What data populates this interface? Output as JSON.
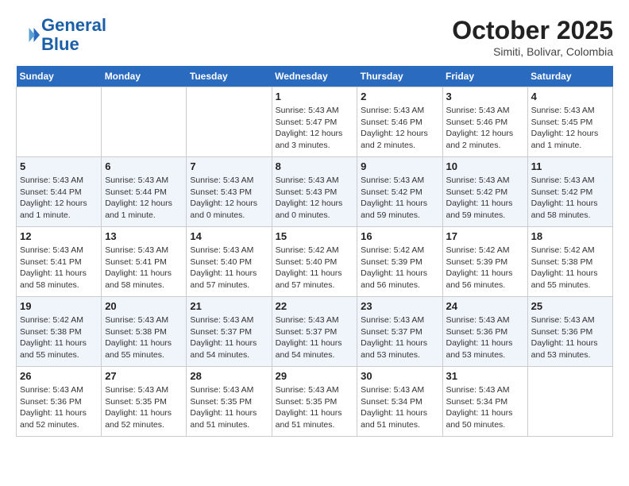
{
  "header": {
    "logo_line1": "General",
    "logo_line2": "Blue",
    "month": "October 2025",
    "location": "Simiti, Bolivar, Colombia"
  },
  "days_of_week": [
    "Sunday",
    "Monday",
    "Tuesday",
    "Wednesday",
    "Thursday",
    "Friday",
    "Saturday"
  ],
  "weeks": [
    [
      {
        "day": "",
        "info": ""
      },
      {
        "day": "",
        "info": ""
      },
      {
        "day": "",
        "info": ""
      },
      {
        "day": "1",
        "info": "Sunrise: 5:43 AM\nSunset: 5:47 PM\nDaylight: 12 hours and 3 minutes."
      },
      {
        "day": "2",
        "info": "Sunrise: 5:43 AM\nSunset: 5:46 PM\nDaylight: 12 hours and 2 minutes."
      },
      {
        "day": "3",
        "info": "Sunrise: 5:43 AM\nSunset: 5:46 PM\nDaylight: 12 hours and 2 minutes."
      },
      {
        "day": "4",
        "info": "Sunrise: 5:43 AM\nSunset: 5:45 PM\nDaylight: 12 hours and 1 minute."
      }
    ],
    [
      {
        "day": "5",
        "info": "Sunrise: 5:43 AM\nSunset: 5:44 PM\nDaylight: 12 hours and 1 minute."
      },
      {
        "day": "6",
        "info": "Sunrise: 5:43 AM\nSunset: 5:44 PM\nDaylight: 12 hours and 1 minute."
      },
      {
        "day": "7",
        "info": "Sunrise: 5:43 AM\nSunset: 5:43 PM\nDaylight: 12 hours and 0 minutes."
      },
      {
        "day": "8",
        "info": "Sunrise: 5:43 AM\nSunset: 5:43 PM\nDaylight: 12 hours and 0 minutes."
      },
      {
        "day": "9",
        "info": "Sunrise: 5:43 AM\nSunset: 5:42 PM\nDaylight: 11 hours and 59 minutes."
      },
      {
        "day": "10",
        "info": "Sunrise: 5:43 AM\nSunset: 5:42 PM\nDaylight: 11 hours and 59 minutes."
      },
      {
        "day": "11",
        "info": "Sunrise: 5:43 AM\nSunset: 5:42 PM\nDaylight: 11 hours and 58 minutes."
      }
    ],
    [
      {
        "day": "12",
        "info": "Sunrise: 5:43 AM\nSunset: 5:41 PM\nDaylight: 11 hours and 58 minutes."
      },
      {
        "day": "13",
        "info": "Sunrise: 5:43 AM\nSunset: 5:41 PM\nDaylight: 11 hours and 58 minutes."
      },
      {
        "day": "14",
        "info": "Sunrise: 5:43 AM\nSunset: 5:40 PM\nDaylight: 11 hours and 57 minutes."
      },
      {
        "day": "15",
        "info": "Sunrise: 5:42 AM\nSunset: 5:40 PM\nDaylight: 11 hours and 57 minutes."
      },
      {
        "day": "16",
        "info": "Sunrise: 5:42 AM\nSunset: 5:39 PM\nDaylight: 11 hours and 56 minutes."
      },
      {
        "day": "17",
        "info": "Sunrise: 5:42 AM\nSunset: 5:39 PM\nDaylight: 11 hours and 56 minutes."
      },
      {
        "day": "18",
        "info": "Sunrise: 5:42 AM\nSunset: 5:38 PM\nDaylight: 11 hours and 55 minutes."
      }
    ],
    [
      {
        "day": "19",
        "info": "Sunrise: 5:42 AM\nSunset: 5:38 PM\nDaylight: 11 hours and 55 minutes."
      },
      {
        "day": "20",
        "info": "Sunrise: 5:43 AM\nSunset: 5:38 PM\nDaylight: 11 hours and 55 minutes."
      },
      {
        "day": "21",
        "info": "Sunrise: 5:43 AM\nSunset: 5:37 PM\nDaylight: 11 hours and 54 minutes."
      },
      {
        "day": "22",
        "info": "Sunrise: 5:43 AM\nSunset: 5:37 PM\nDaylight: 11 hours and 54 minutes."
      },
      {
        "day": "23",
        "info": "Sunrise: 5:43 AM\nSunset: 5:37 PM\nDaylight: 11 hours and 53 minutes."
      },
      {
        "day": "24",
        "info": "Sunrise: 5:43 AM\nSunset: 5:36 PM\nDaylight: 11 hours and 53 minutes."
      },
      {
        "day": "25",
        "info": "Sunrise: 5:43 AM\nSunset: 5:36 PM\nDaylight: 11 hours and 53 minutes."
      }
    ],
    [
      {
        "day": "26",
        "info": "Sunrise: 5:43 AM\nSunset: 5:36 PM\nDaylight: 11 hours and 52 minutes."
      },
      {
        "day": "27",
        "info": "Sunrise: 5:43 AM\nSunset: 5:35 PM\nDaylight: 11 hours and 52 minutes."
      },
      {
        "day": "28",
        "info": "Sunrise: 5:43 AM\nSunset: 5:35 PM\nDaylight: 11 hours and 51 minutes."
      },
      {
        "day": "29",
        "info": "Sunrise: 5:43 AM\nSunset: 5:35 PM\nDaylight: 11 hours and 51 minutes."
      },
      {
        "day": "30",
        "info": "Sunrise: 5:43 AM\nSunset: 5:34 PM\nDaylight: 11 hours and 51 minutes."
      },
      {
        "day": "31",
        "info": "Sunrise: 5:43 AM\nSunset: 5:34 PM\nDaylight: 11 hours and 50 minutes."
      },
      {
        "day": "",
        "info": ""
      }
    ]
  ]
}
